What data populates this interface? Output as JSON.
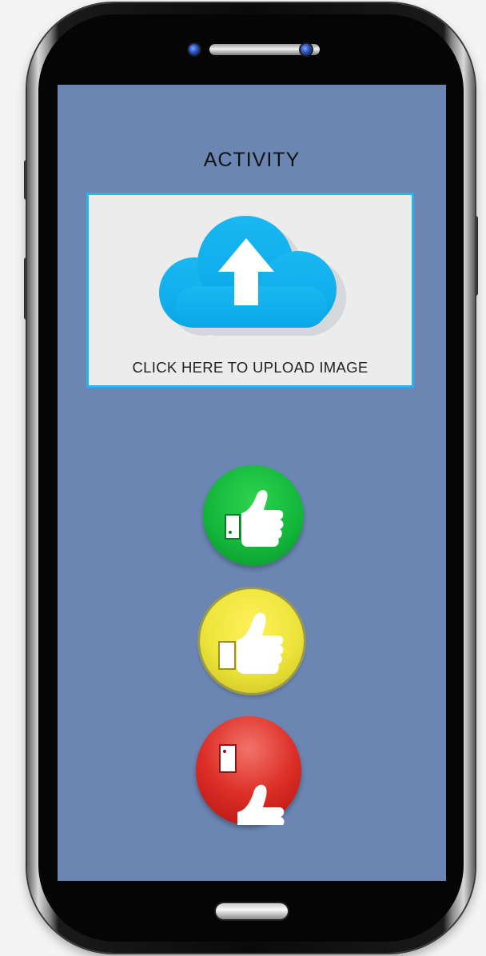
{
  "screen": {
    "title": "ACTIVITY",
    "upload": {
      "label": "CLICK HERE TO UPLOAD IMAGE",
      "icon": "cloud-upload-icon"
    },
    "ratings": [
      {
        "name": "like",
        "icon": "thumbs-up-icon",
        "color": "#12b53a"
      },
      {
        "name": "neutral",
        "icon": "thumbs-up-icon",
        "color": "#ece43a"
      },
      {
        "name": "dislike",
        "icon": "thumbs-down-icon",
        "color": "#dc2e26"
      }
    ]
  },
  "colors": {
    "screen_background": "#6b86b3",
    "upload_border": "#22b5ee",
    "cloud": "#0fb1ec"
  }
}
